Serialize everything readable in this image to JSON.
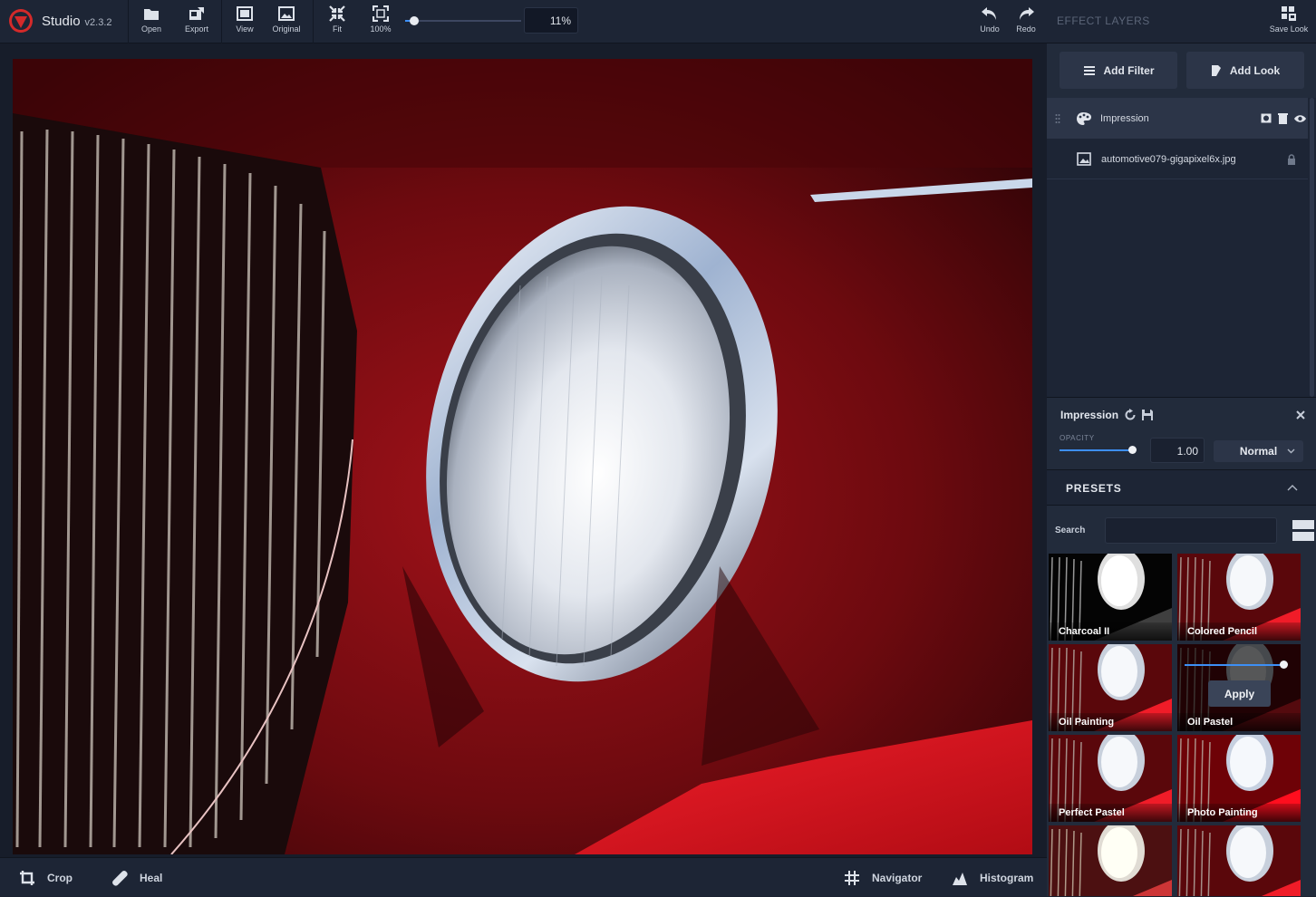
{
  "app": {
    "name": "Studio",
    "version": "v2.3.2"
  },
  "toolbar": {
    "open": "Open",
    "export": "Export",
    "view": "View",
    "original": "Original",
    "fit": "Fit",
    "actual": "100%",
    "undo": "Undo",
    "redo": "Redo",
    "zoom_value": "11%",
    "zoom_fraction": 0.08
  },
  "bottom": {
    "crop": "Crop",
    "heal": "Heal",
    "navigator": "Navigator",
    "histogram": "Histogram"
  },
  "panel": {
    "title": "EFFECT LAYERS",
    "save_look": "Save Look",
    "add_filter": "Add Filter",
    "add_look": "Add Look",
    "layers": [
      {
        "name": "Impression"
      },
      {
        "name": "automotive079-gigapixel6x.jpg"
      }
    ]
  },
  "props": {
    "title": "Impression",
    "opacity_label": "OPACITY",
    "opacity_value": "1.00",
    "opacity_fraction": 1.0,
    "blend_mode": "Normal"
  },
  "presets": {
    "title": "PRESETS",
    "search_label": "Search",
    "search_value": "",
    "apply_label": "Apply",
    "items": [
      {
        "name": "Charcoal II"
      },
      {
        "name": "Colored Pencil"
      },
      {
        "name": "Oil Painting"
      },
      {
        "name": "Oil Pastel"
      },
      {
        "name": "Perfect Pastel"
      },
      {
        "name": "Photo Painting"
      },
      {
        "name": ""
      },
      {
        "name": ""
      }
    ]
  },
  "colors": {
    "accent": "#3d8ff5",
    "selection": "#2f7fe4",
    "brand_red": "#d42a2a"
  },
  "icons": {
    "open": "folder-icon",
    "export": "export-icon",
    "view": "view-icon",
    "original": "image-icon",
    "fit": "fit-icon",
    "actual": "fullscreen-icon",
    "undo": "undo-icon",
    "redo": "redo-icon",
    "save_look": "save-look-icon",
    "crop": "crop-icon",
    "heal": "bandage-icon",
    "navigator": "grid-icon",
    "histogram": "histogram-icon"
  }
}
